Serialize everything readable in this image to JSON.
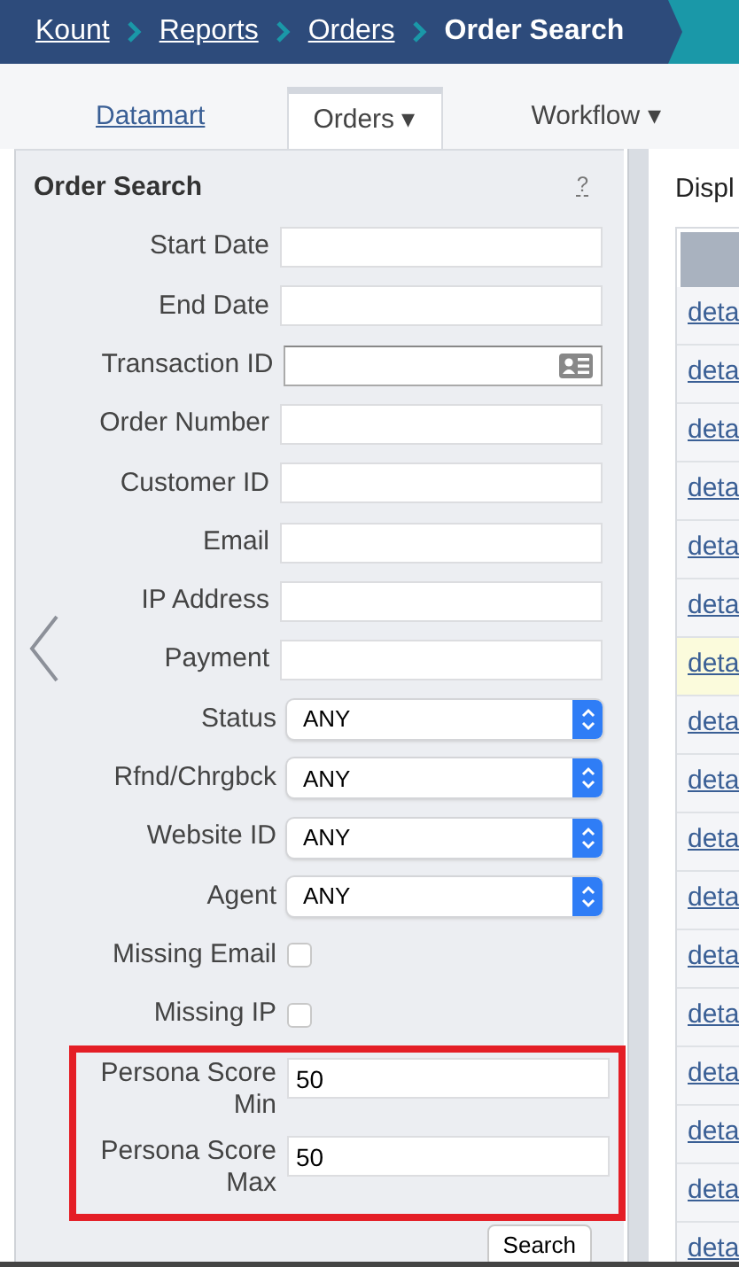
{
  "breadcrumb": [
    {
      "label": "Kount",
      "kind": "link"
    },
    {
      "label": "Reports",
      "kind": "link"
    },
    {
      "label": "Orders",
      "kind": "link"
    },
    {
      "label": "Order Search",
      "kind": "current"
    }
  ],
  "tabs": [
    {
      "label": "Datamart",
      "kind": "link",
      "selected": false
    },
    {
      "label": "Orders ▾",
      "kind": "menu",
      "selected": true
    },
    {
      "label": "Workflow ▾",
      "kind": "menu",
      "selected": false
    }
  ],
  "search_panel": {
    "title": "Order Search",
    "help": "?",
    "fields": [
      {
        "label": "Start Date",
        "kind": "text"
      },
      {
        "label": "End Date",
        "kind": "text"
      },
      {
        "label": "Transaction ID",
        "kind": "card"
      },
      {
        "label": "Order Number",
        "kind": "text"
      },
      {
        "label": "Customer ID",
        "kind": "text"
      },
      {
        "label": "Email",
        "kind": "text"
      },
      {
        "label": "IP Address",
        "kind": "text"
      },
      {
        "label": "Payment",
        "kind": "text"
      },
      {
        "label": "Status",
        "kind": "select",
        "value": "ANY"
      },
      {
        "label": "Rfnd/Chrgbck",
        "kind": "select",
        "value": "ANY"
      },
      {
        "label": "Website ID",
        "kind": "select",
        "value": "ANY"
      },
      {
        "label": "Agent",
        "kind": "select",
        "value": "ANY"
      },
      {
        "label": "Missing Email",
        "kind": "checkbox",
        "checked": false
      },
      {
        "label": "Missing IP",
        "kind": "checkbox",
        "checked": false
      }
    ],
    "highlighted_fields": [
      {
        "label": "Persona Score Min",
        "kind": "text",
        "value": "50"
      },
      {
        "label": "Persona Score Max",
        "kind": "text",
        "value": "50"
      }
    ],
    "search_button": "Search"
  },
  "results": {
    "caption": "Displ",
    "rows": [
      {
        "link": "deta",
        "highlighted": false
      },
      {
        "link": "deta",
        "highlighted": false
      },
      {
        "link": "deta",
        "highlighted": false
      },
      {
        "link": "deta",
        "highlighted": false
      },
      {
        "link": "deta",
        "highlighted": false
      },
      {
        "link": "deta",
        "highlighted": false
      },
      {
        "link": "deta",
        "highlighted": true
      },
      {
        "link": "deta",
        "highlighted": false
      },
      {
        "link": "deta",
        "highlighted": false
      },
      {
        "link": "deta",
        "highlighted": false
      },
      {
        "link": "deta",
        "highlighted": false
      },
      {
        "link": "deta",
        "highlighted": false
      },
      {
        "link": "deta",
        "highlighted": false
      },
      {
        "link": "deta",
        "highlighted": false
      },
      {
        "link": "deta",
        "highlighted": false
      },
      {
        "link": "deta",
        "highlighted": false
      },
      {
        "link": "deta",
        "highlighted": false
      }
    ]
  }
}
